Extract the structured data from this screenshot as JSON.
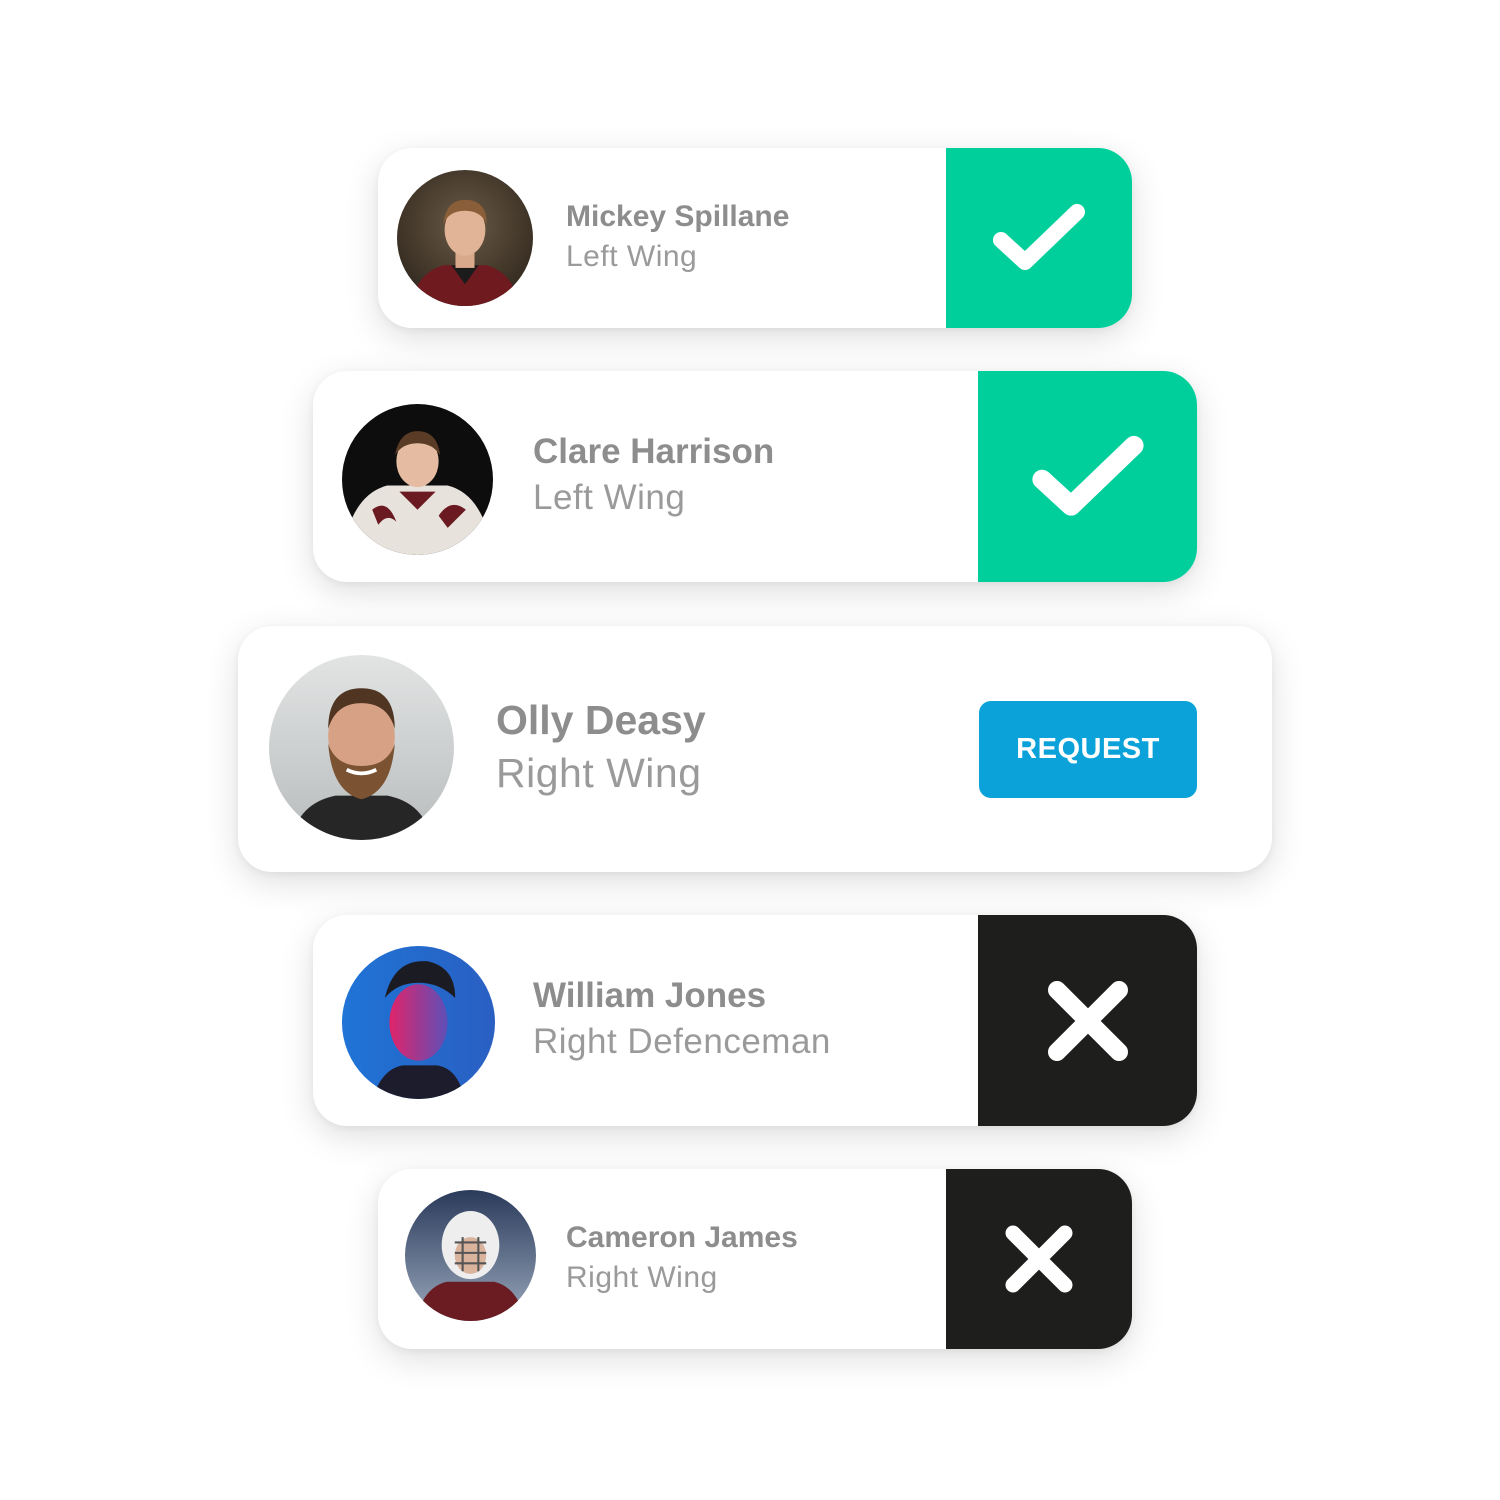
{
  "colors": {
    "accept": "#00cf9c",
    "reject": "#1e1e1c",
    "request": "#0aa2d9",
    "name_text": "#8d8d8d",
    "position_text": "#9a9a9a"
  },
  "players": [
    {
      "name": "Mickey Spillane",
      "position": "Left Wing",
      "status": "accepted",
      "action_icon": "check-icon"
    },
    {
      "name": "Clare Harrison",
      "position": "Left Wing",
      "status": "accepted",
      "action_icon": "check-icon"
    },
    {
      "name": "Olly Deasy",
      "position": "Right Wing",
      "status": "pending",
      "action_label": "REQUEST"
    },
    {
      "name": "William Jones",
      "position": "Right Defenceman",
      "status": "rejected",
      "action_icon": "close-icon"
    },
    {
      "name": "Cameron James",
      "position": "Right Wing",
      "status": "rejected",
      "action_icon": "close-icon"
    }
  ]
}
